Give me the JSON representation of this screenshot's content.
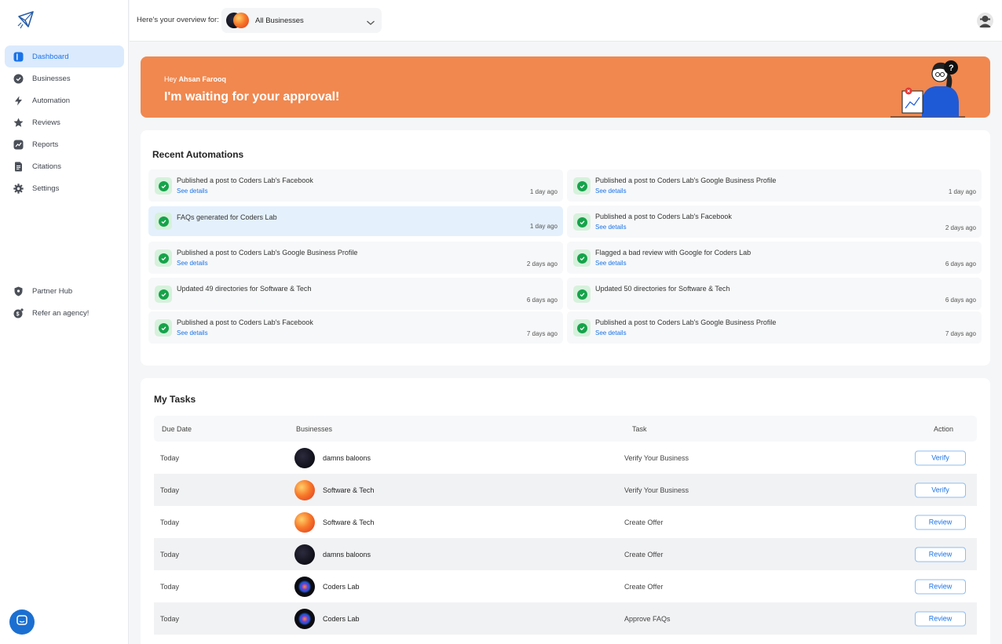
{
  "header": {
    "overview_label": "Here's your overview for:",
    "business_select": "All Businesses"
  },
  "sidebar": {
    "items": [
      {
        "label": "Dashboard",
        "icon": "dashboard-icon",
        "active": true
      },
      {
        "label": "Businesses",
        "icon": "badge-check-icon"
      },
      {
        "label": "Automation",
        "icon": "lightning-icon"
      },
      {
        "label": "Reviews",
        "icon": "star-icon"
      },
      {
        "label": "Reports",
        "icon": "chart-icon"
      },
      {
        "label": "Citations",
        "icon": "document-icon"
      },
      {
        "label": "Settings",
        "icon": "gear-icon"
      }
    ],
    "bottom_items": [
      {
        "label": "Partner Hub",
        "icon": "shield-icon"
      },
      {
        "label": "Refer an agency!",
        "icon": "gift-icon"
      }
    ]
  },
  "banner": {
    "greeting_prefix": "Hey",
    "user_name": "Ahsan Farooq",
    "title": "I'm waiting for your approval!"
  },
  "automations": {
    "title": "Recent Automations",
    "items": [
      {
        "text": "Published a post to Coders Lab's Facebook",
        "link": "See details",
        "time": "1 day ago"
      },
      {
        "text": "Published a post to Coders Lab's Google Business Profile",
        "link": "See details",
        "time": "1 day ago"
      },
      {
        "text": "FAQs generated for Coders Lab",
        "link": "",
        "time": "1 day ago"
      },
      {
        "text": "Published a post to Coders Lab's Facebook",
        "link": "See details",
        "time": "2 days ago"
      },
      {
        "text": "Published a post to Coders Lab's Google Business Profile",
        "link": "See details",
        "time": "2 days ago"
      },
      {
        "text": "Flagged a bad review with Google for Coders Lab",
        "link": "See details",
        "time": "6 days ago"
      },
      {
        "text": "Updated 49 directories for Software & Tech",
        "link": "",
        "time": "6 days ago"
      },
      {
        "text": "Updated 50 directories for Software & Tech",
        "link": "",
        "time": "6 days ago"
      },
      {
        "text": "Published a post to Coders Lab's Facebook",
        "link": "See details",
        "time": "7 days ago"
      },
      {
        "text": "Published a post to Coders Lab's Google Business Profile",
        "link": "See details",
        "time": "7 days ago"
      }
    ]
  },
  "tasks": {
    "title": "My Tasks",
    "columns": [
      "Due Date",
      "Businesses",
      "Task",
      "Action"
    ],
    "rows": [
      {
        "date": "Today",
        "business": "damns baloons",
        "task": "Verify Your Business",
        "action": "Verify"
      },
      {
        "date": "Today",
        "business": "Software & Tech",
        "task": "Verify Your Business",
        "action": "Verify"
      },
      {
        "date": "Today",
        "business": "Software & Tech",
        "task": "Create Offer",
        "action": "Review"
      },
      {
        "date": "Today",
        "business": "damns baloons",
        "task": "Create Offer",
        "action": "Review"
      },
      {
        "date": "Today",
        "business": "Coders Lab",
        "task": "Create Offer",
        "action": "Review"
      },
      {
        "date": "Today",
        "business": "Coders Lab",
        "task": "Approve FAQs",
        "action": "Review"
      }
    ]
  },
  "colors": {
    "accent": "#1a73e8",
    "banner": "#f0884f",
    "success": "#16a34a"
  }
}
